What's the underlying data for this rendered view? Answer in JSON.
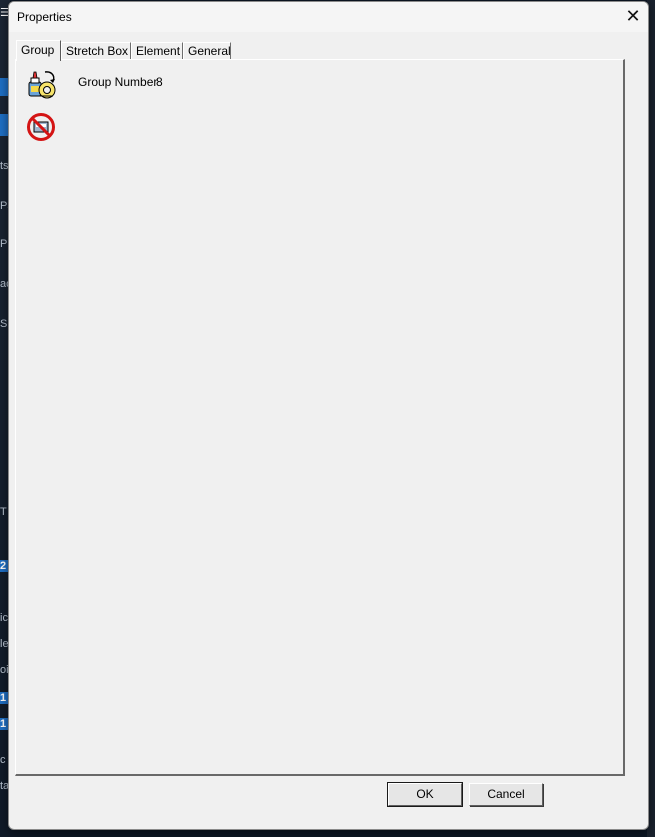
{
  "window": {
    "title": "Properties",
    "close_glyph": "✕"
  },
  "tabs": [
    {
      "label": "Group",
      "active": true
    },
    {
      "label": "Stretch Box",
      "active": false
    },
    {
      "label": "Element",
      "active": false
    },
    {
      "label": "General",
      "active": false
    }
  ],
  "group_tab": {
    "group_number_label": "Group Number",
    "group_number_value": "8",
    "icons": [
      "glue-tape-group-icon",
      "no-group-icon"
    ]
  },
  "buttons": {
    "ok_label": "OK",
    "cancel_label": "Cancel"
  },
  "background_fragments": [
    "ts",
    "Pa",
    "Pi",
    "ac",
    "Sp",
    "T",
    "2",
    "ic",
    "le",
    "oi",
    "1",
    "1",
    "c",
    "ta"
  ],
  "colors": {
    "dialog_bg": "#f0f0f0",
    "accent_blue": "#1f6fc4"
  }
}
